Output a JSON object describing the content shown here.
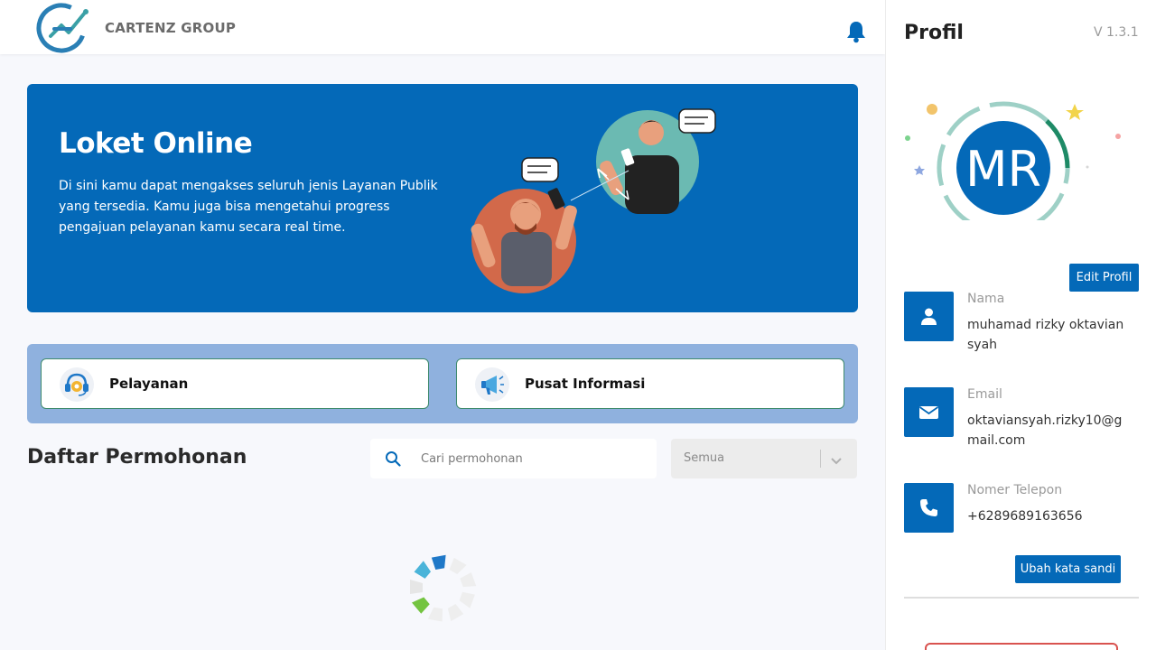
{
  "header": {
    "brand": "CARTENZ GROUP"
  },
  "banner": {
    "title": "Loket Online",
    "description": "Di sini kamu dapat mengakses seluruh jenis Layanan Publik yang tersedia. Kamu juga bisa mengetahui progress pengajuan pelayanan kamu secara real time."
  },
  "menu": {
    "items": [
      {
        "label": "Pelayanan",
        "icon": "customer-service-icon"
      },
      {
        "label": "Pusat Informasi",
        "icon": "megaphone-icon"
      }
    ]
  },
  "list": {
    "title": "Daftar Permohonan",
    "search_placeholder": "Cari permohonan",
    "filter_value": "Semua"
  },
  "profile": {
    "title": "Profil",
    "version": "V 1.3.1",
    "initials": "MR",
    "edit_label": "Edit Profil",
    "fields": [
      {
        "label": "Nama",
        "value": "muhamad rizky oktaviansyah",
        "icon": "user-icon"
      },
      {
        "label": "Email",
        "value": "oktaviansyah.rizky10@gmail.com",
        "icon": "envelope-icon"
      },
      {
        "label": "Nomer Telepon",
        "value": "+6289689163656",
        "icon": "phone-icon"
      }
    ],
    "change_password_label": "Ubah kata sandi"
  },
  "colors": {
    "primary": "#0469b8",
    "menu_panel": "#8fb1de",
    "background": "#f7f8fc"
  }
}
